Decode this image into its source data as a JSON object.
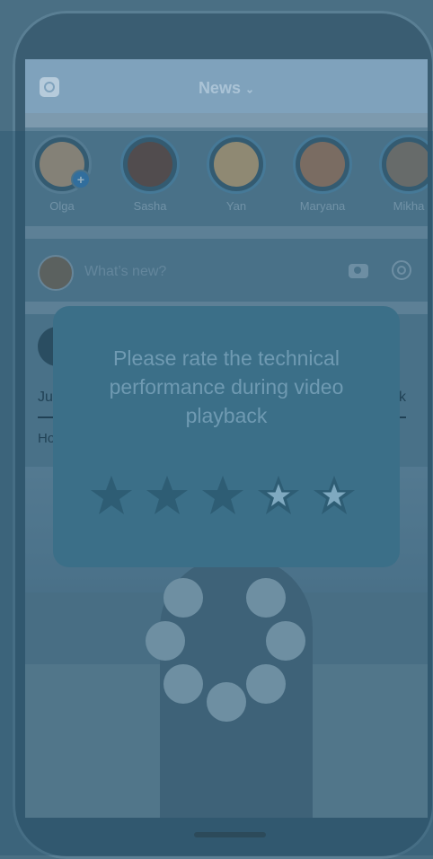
{
  "header": {
    "title": "News",
    "camera_icon": "camera-icon",
    "chevron_icon": "chevron-down-icon"
  },
  "stories": [
    {
      "name": "Olga",
      "face": "#b89c7e",
      "has_add": true
    },
    {
      "name": "Sasha",
      "face": "#6b4a3f",
      "has_add": false
    },
    {
      "name": "Yan",
      "face": "#caa878",
      "has_add": false
    },
    {
      "name": "Maryana",
      "face": "#a97b5f",
      "has_add": false
    },
    {
      "name": "Mikha",
      "face": "#8d7a6a",
      "has_add": false
    }
  ],
  "composer": {
    "placeholder": "What’s new?"
  },
  "post": {
    "name_prefix": "Ju",
    "side_text": "ok",
    "text_prefix": "Ho"
  },
  "dialog": {
    "message": "Please rate the technical performance during video playback",
    "rating": 3,
    "max_rating": 5
  },
  "colors": {
    "overlay": "#3b6f88",
    "star_filled": "#2e5d74",
    "star_empty": "#cfe0ec"
  }
}
